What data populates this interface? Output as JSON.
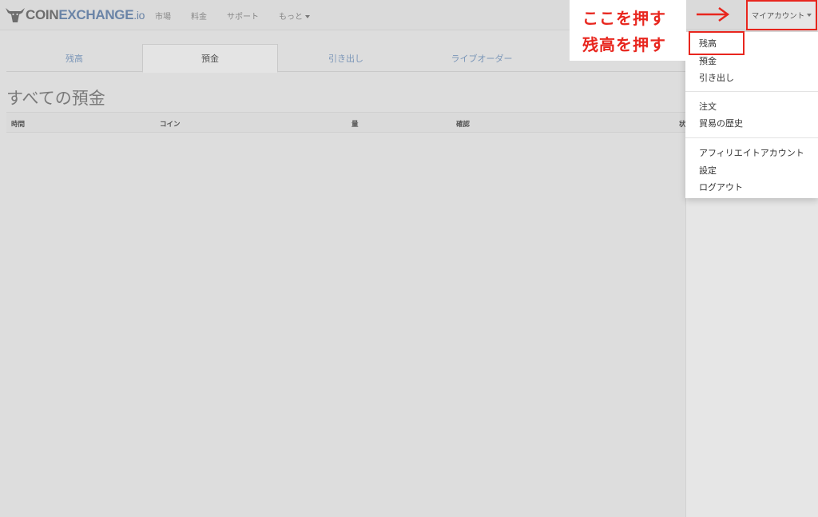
{
  "navbar": {
    "brand": {
      "coin": "COIN",
      "exchange": "EXCHANGE",
      "io": ".io"
    },
    "links": [
      "市場",
      "料金",
      "サポート",
      "もっと"
    ],
    "account_button": "マイアカウント"
  },
  "tabs": [
    {
      "label": "残高"
    },
    {
      "label": "預金"
    },
    {
      "label": "引き出し"
    },
    {
      "label": "ライブオーダー"
    }
  ],
  "main": {
    "title": "すべての預金",
    "columns": [
      "時間",
      "コイン",
      "量",
      "確認",
      "状"
    ]
  },
  "dropdown": {
    "items": [
      "残高",
      "預金",
      "引き出し",
      "注文",
      "貿易の歴史",
      "アフィリエイトアカウント",
      "設定",
      "ログアウト"
    ]
  },
  "annotation": {
    "line1": "ここを押す",
    "line2": "残高を押す"
  },
  "colors": {
    "accent_red": "#e8261e",
    "link_blue": "#7b96b8"
  }
}
